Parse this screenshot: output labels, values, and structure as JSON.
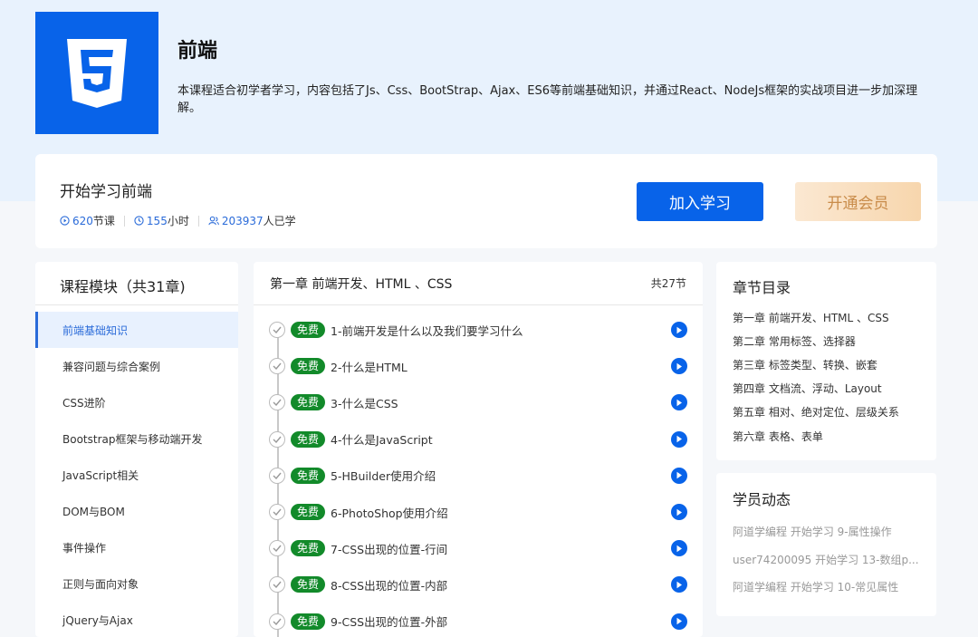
{
  "hero": {
    "title": "前端",
    "description": "本课程适合初学者学习，内容包括了Js、Css、BootStrap、Ajax、ES6等前端基础知识，并通过React、NodeJs框架的实战项目进一步加深理解。",
    "logo_icon": "html5-icon"
  },
  "start": {
    "title": "开始学习前端",
    "lessons_num": "620",
    "lessons_unit": "节课",
    "hours_num": "155",
    "hours_unit": "小时",
    "learners_num": "203937",
    "learners_unit": "人已学",
    "join_label": "加入学习",
    "vip_label": "开通会员"
  },
  "modules": {
    "title": "课程模块（共31章)",
    "items": [
      "前端基础知识",
      "兼容问题与综合案例",
      "CSS进阶",
      "Bootstrap框架与移动端开发",
      "JavaScript相关",
      "DOM与BOM",
      "事件操作",
      "正则与面向对象",
      "jQuery与Ajax"
    ]
  },
  "chapter": {
    "title": "第一章 前端开发、HTML 、CSS",
    "count": "共27节",
    "free_label": "免费",
    "lessons": [
      "1-前端开发是什么以及我们要学习什么",
      "2-什么是HTML",
      "3-什么是CSS",
      "4-什么是JavaScript",
      "5-HBuilder使用介绍",
      "6-PhotoShop使用介绍",
      "7-CSS出现的位置-行间",
      "8-CSS出现的位置-内部",
      "9-CSS出现的位置-外部"
    ]
  },
  "toc": {
    "title": "章节目录",
    "items": [
      "第一章 前端开发、HTML 、CSS",
      "第二章 常用标签、选择器",
      "第三章 标签类型、转换、嵌套",
      "第四章 文档流、浮动、Layout",
      "第五章 相对、绝对定位、层级关系",
      "第六章 表格、表单"
    ]
  },
  "feed": {
    "title": "学员动态",
    "items": [
      "阿道学编程 开始学习 9-属性操作",
      "user74200095 开始学习 13-数组p...",
      "阿道学编程 开始学习 10-常见属性"
    ]
  },
  "colors": {
    "primary": "#0863e9",
    "free_badge": "#128a2a",
    "hero_bg": "#e8f2fd"
  }
}
